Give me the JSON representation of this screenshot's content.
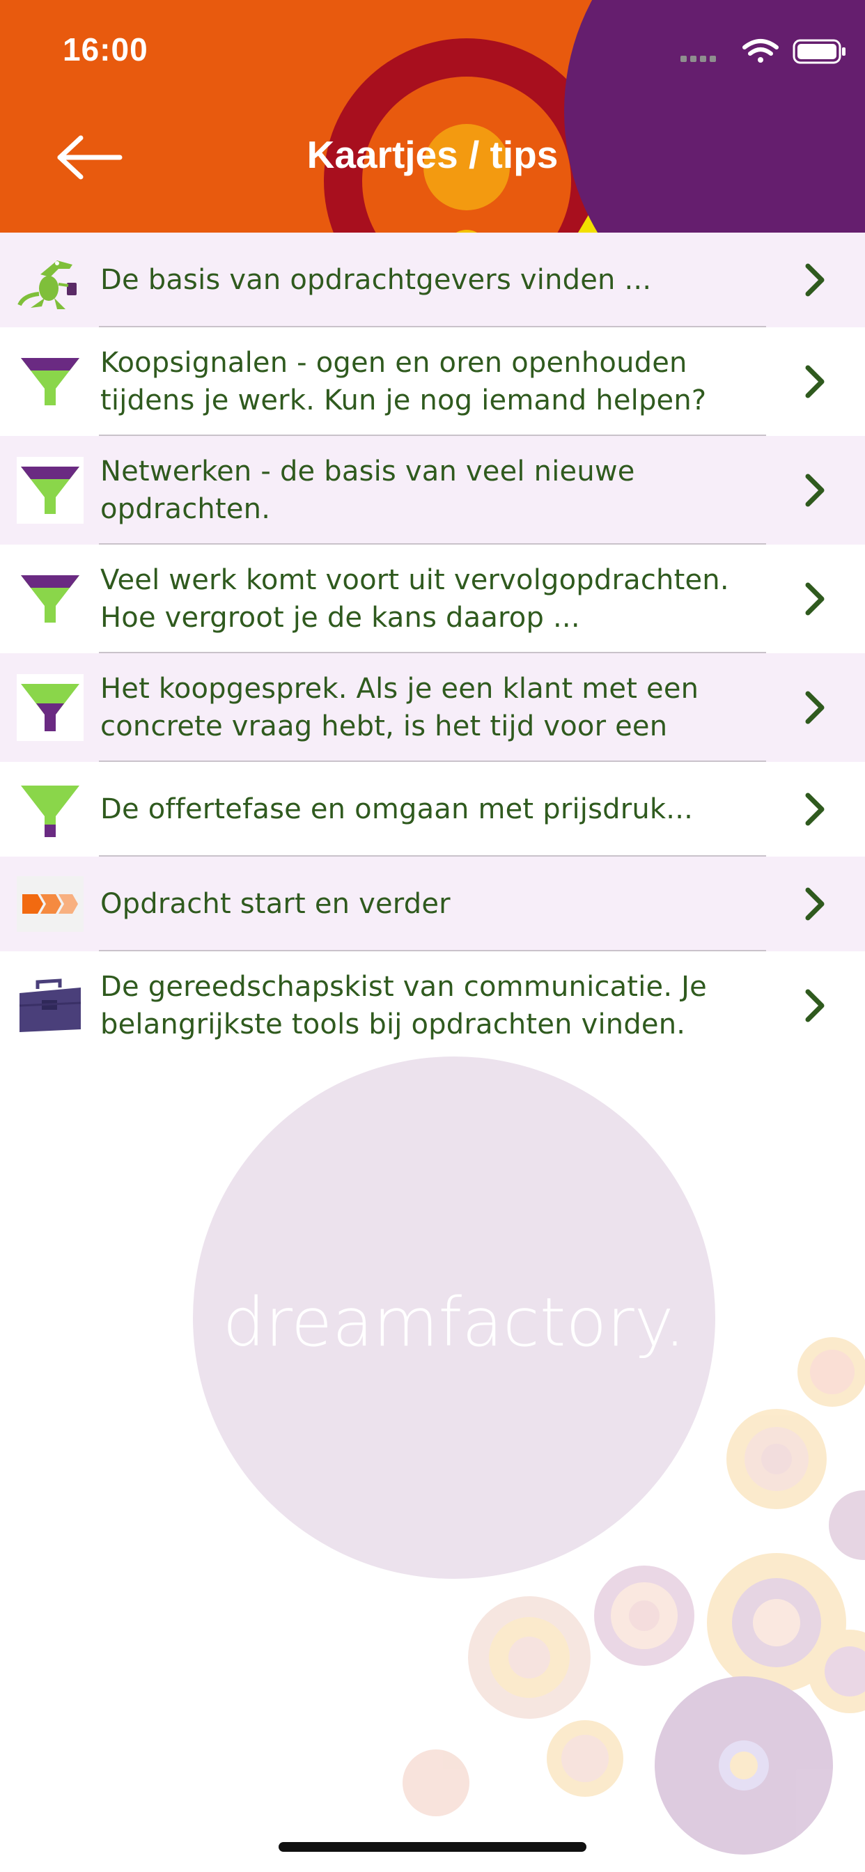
{
  "status_bar": {
    "time": "16:00"
  },
  "header": {
    "title": "Kaartjes / tips",
    "back_icon": "arrow-left-icon"
  },
  "colors": {
    "header_orange": "#e85a0e",
    "header_purple": "#651e6e",
    "text_green": "#2f5a1e",
    "row_shade": "#f7eef9",
    "funnel_green": "#8ad64a",
    "funnel_purple": "#6a2a82"
  },
  "list": {
    "items": [
      {
        "label": "De basis van opdrachtgevers vinden ...",
        "icon": "crocodile-icon"
      },
      {
        "label": "Koopsignalen - ogen en oren openhouden tijdens je werk. Kun je nog iemand helpen?",
        "icon": "funnel-top-icon"
      },
      {
        "label": "Netwerken - de basis van veel nieuwe opdrachten.",
        "icon": "funnel-top-icon"
      },
      {
        "label": "Veel werk komt voort uit vervolgopdrachten. Hoe vergroot je de kans daarop ...",
        "icon": "funnel-top-icon"
      },
      {
        "label": "Het koopgesprek. Als je een klant met een concrete vraag hebt, is het tijd voor een",
        "icon": "funnel-middle-icon"
      },
      {
        "label": "De offertefase en omgaan met prijsdruk...",
        "icon": "funnel-bottom-icon"
      },
      {
        "label": "Opdracht start en verder",
        "icon": "arrows-icon"
      },
      {
        "label": "De gereedschapskist van communicatie. Je belangrijkste tools bij opdrachten vinden.",
        "icon": "toolbox-icon"
      }
    ]
  },
  "watermark": {
    "logo_text": "dreamfactory."
  }
}
